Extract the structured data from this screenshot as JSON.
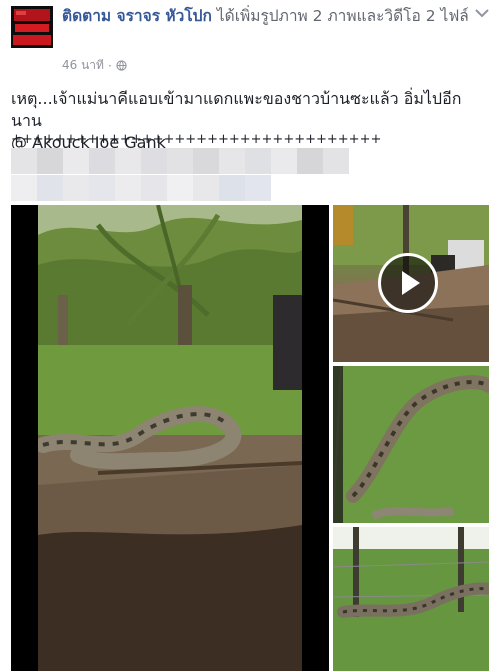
{
  "post": {
    "author": "ติดตาม จราจร หัวโปก",
    "action": "ได้เพิ่มรูปภาพ 2 ภาพและวิดีโอ 2 ไฟล์",
    "timestamp": "46 นาที",
    "dot": "·",
    "caption_line1": "เหตุ...เจ้าแม่นาคีแอบเข้ามาแดกแพะของชาวบ้านซะแล้ว อิ่มไปอีกนาน",
    "caption_line2": "@ Akouck Joe Gank",
    "separator": "++++++++++++++++++++++++++++++++++"
  },
  "icons": {
    "privacy": "globe-icon",
    "menu": "chevron-down-icon",
    "play": "play-icon"
  },
  "colors": {
    "author_link": "#365899",
    "text": "#1d2129",
    "meta": "#90949c"
  },
  "media": {
    "layout": "one large video on the left, three thumbnails stacked on the right",
    "main": "video",
    "thumbnails": [
      "video",
      "photo",
      "photo"
    ]
  }
}
